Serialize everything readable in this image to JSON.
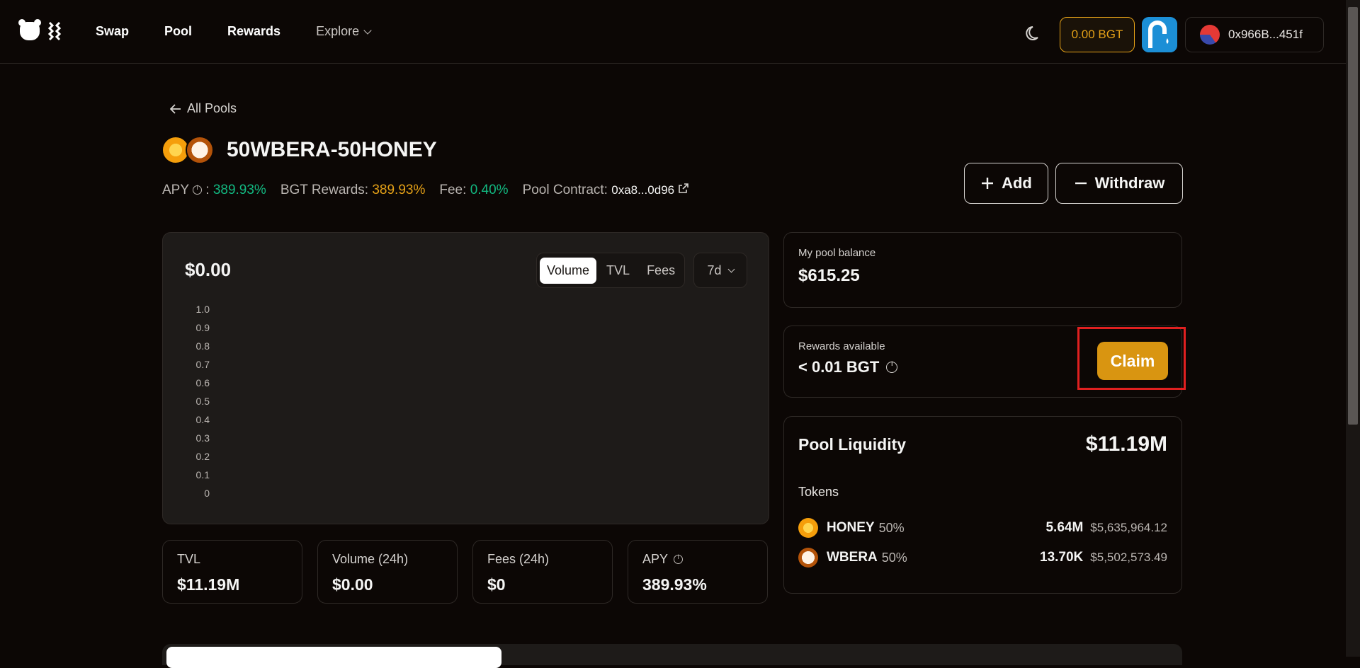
{
  "header": {
    "nav": [
      "Swap",
      "Pool",
      "Rewards"
    ],
    "explore": "Explore",
    "bgt_balance": "0.00 BGT",
    "wallet_address": "0x966B...451f"
  },
  "pool": {
    "back_label": "All Pools",
    "title": "50WBERA-50HONEY",
    "apy_label": "APY",
    "apy_sep": ":",
    "apy": "389.93%",
    "bgt_rewards_label": "BGT Rewards:",
    "bgt_rewards": "389.93%",
    "fee_label": "Fee:",
    "fee": "0.40%",
    "contract_label": "Pool Contract:",
    "contract": "0xa8...0d96",
    "add_label": "Add",
    "withdraw_label": "Withdraw"
  },
  "chart": {
    "value": "$0.00",
    "tabs": [
      "Volume",
      "TVL",
      "Fees"
    ],
    "active_tab": "Volume",
    "period": "7d"
  },
  "chart_data": {
    "type": "bar",
    "categories": [],
    "values": [],
    "title": "",
    "xlabel": "",
    "ylabel": "",
    "ylim": [
      0,
      1.0
    ],
    "yticks": [
      "1.0",
      "0.9",
      "0.8",
      "0.7",
      "0.6",
      "0.5",
      "0.4",
      "0.3",
      "0.2",
      "0.1",
      "0"
    ]
  },
  "stats": [
    {
      "label": "TVL",
      "value": "$11.19M",
      "info": false
    },
    {
      "label": "Volume (24h)",
      "value": "$0.00",
      "info": false
    },
    {
      "label": "Fees (24h)",
      "value": "$0",
      "info": false
    },
    {
      "label": "APY",
      "value": "389.93%",
      "info": true
    }
  ],
  "balance": {
    "label": "My pool balance",
    "value": "$615.25"
  },
  "rewards": {
    "label": "Rewards available",
    "value": "< 0.01 BGT",
    "claim_label": "Claim"
  },
  "liquidity": {
    "title": "Pool Liquidity",
    "value": "$11.19M",
    "tokens_label": "Tokens",
    "tokens": [
      {
        "name": "HONEY",
        "pct": "50%",
        "amount": "5.64M",
        "usd": "$5,635,964.12"
      },
      {
        "name": "WBERA",
        "pct": "50%",
        "amount": "13.70K",
        "usd": "$5,502,573.49"
      }
    ]
  },
  "colors": {
    "accent": "#e5a117",
    "positive": "#12b981",
    "claim": "#d99511",
    "highlight": "#e02020"
  }
}
